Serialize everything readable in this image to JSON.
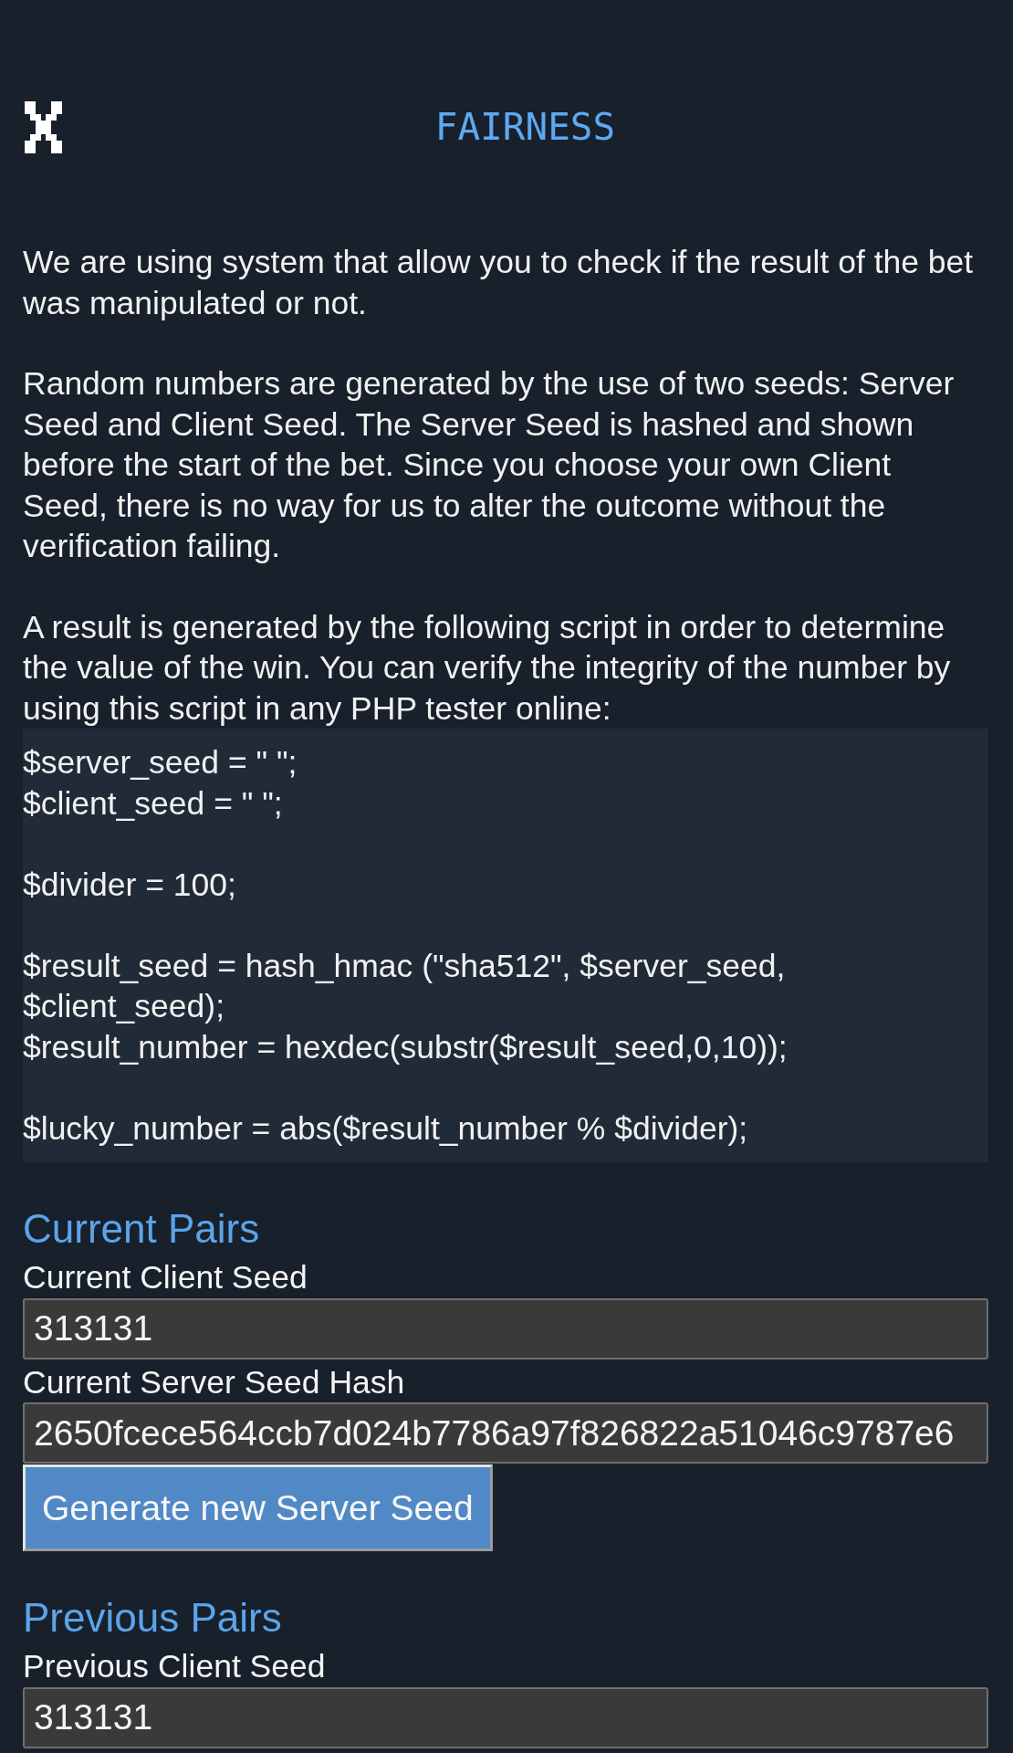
{
  "header": {
    "title": "FAIRNESS"
  },
  "intro": {
    "paragraphs": [
      "We are using system that allow you to check if the result of the bet\nwas manipulated or not.",
      "Random numbers are generated by the use of two seeds: Server\nSeed and Client Seed. The Server Seed is hashed and shown\nbefore the start of the bet. Since you choose your own Client\nSeed, there is no way for us to alter the outcome without the\nverification failing.",
      "A result is generated by the following script in order to determine\nthe value of the win. You can verify the integrity of the number by\nusing this script in any PHP tester online:"
    ],
    "code": "$server_seed = \" \";\n$client_seed = \" \";\n\n$divider = 100;\n\n$result_seed = hash_hmac (\"sha512\", $server_seed,\n$client_seed);\n$result_number = hexdec(substr($result_seed,0,10));\n\n$lucky_number = abs($result_number % $divider);"
  },
  "sections": [
    {
      "heading": "Current Pairs",
      "fields": [
        {
          "label": "Current Client Seed",
          "value": "313131"
        },
        {
          "label": "Current Server Seed Hash",
          "value": "2650fcece564ccb7d024b7786a97f826822a51046c9787e6"
        }
      ],
      "button": "Generate new Server Seed"
    },
    {
      "heading": "Previous Pairs",
      "fields": [
        {
          "label": "Previous Client Seed",
          "value": "313131"
        }
      ]
    }
  ]
}
